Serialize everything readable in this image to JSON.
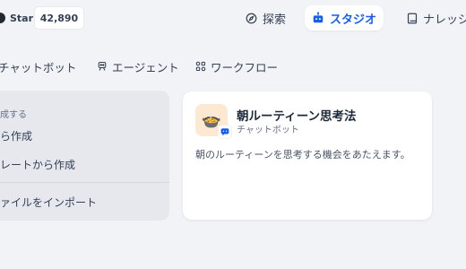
{
  "topbar": {
    "star_label": "Star",
    "star_count": "42,890",
    "nav": {
      "explore": "探索",
      "studio": "スタジオ",
      "knowledge": "ナレッジ"
    },
    "accent_color": "#155eef"
  },
  "tabs": [
    {
      "label": "チャットボット",
      "icon": "chat-bubble-icon"
    },
    {
      "label": "エージェント",
      "icon": "agent-icon"
    },
    {
      "label": "ワークフロー",
      "icon": "workflow-icon"
    }
  ],
  "create": {
    "heading": "成する",
    "blank": "ら作成",
    "template": "レートから作成",
    "import": "ァイルをインポート"
  },
  "apps": [
    {
      "title": "朝ルーティーン思考法",
      "type": "チャットボット",
      "description": "朝のルーティーンを思考する機会をあたえます。",
      "avatar": "🍲"
    }
  ]
}
